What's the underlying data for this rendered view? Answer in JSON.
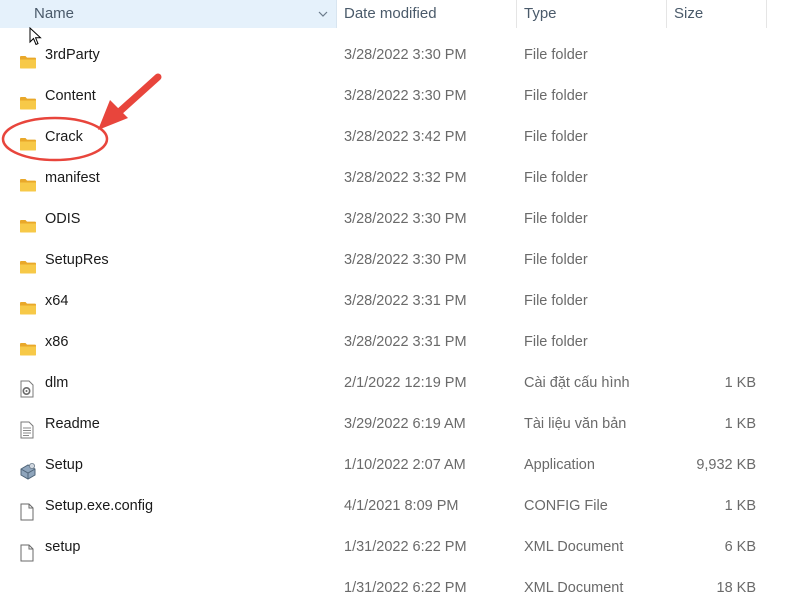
{
  "columns": {
    "name": "Name",
    "date": "Date modified",
    "type": "Type",
    "size": "Size"
  },
  "colors": {
    "folder": "#f4c23d",
    "annotation": "#e8453c",
    "header_selected": "#e5f1fb"
  },
  "rows": [
    {
      "icon": "folder-icon",
      "name": "3rdParty",
      "date": "3/28/2022 3:30 PM",
      "type": "File folder",
      "size": ""
    },
    {
      "icon": "folder-icon",
      "name": "Content",
      "date": "3/28/2022 3:30 PM",
      "type": "File folder",
      "size": ""
    },
    {
      "icon": "folder-icon",
      "name": "Crack",
      "date": "3/28/2022 3:42 PM",
      "type": "File folder",
      "size": ""
    },
    {
      "icon": "folder-icon",
      "name": "manifest",
      "date": "3/28/2022 3:32 PM",
      "type": "File folder",
      "size": ""
    },
    {
      "icon": "folder-icon",
      "name": "ODIS",
      "date": "3/28/2022 3:30 PM",
      "type": "File folder",
      "size": ""
    },
    {
      "icon": "folder-icon",
      "name": "SetupRes",
      "date": "3/28/2022 3:30 PM",
      "type": "File folder",
      "size": ""
    },
    {
      "icon": "folder-icon",
      "name": "x64",
      "date": "3/28/2022 3:31 PM",
      "type": "File folder",
      "size": ""
    },
    {
      "icon": "folder-icon",
      "name": "x86",
      "date": "3/28/2022 3:31 PM",
      "type": "File folder",
      "size": ""
    },
    {
      "icon": "config-settings-icon",
      "name": "dlm",
      "date": "2/1/2022 12:19 PM",
      "type": "Cài đặt cấu hình",
      "size": "1 KB"
    },
    {
      "icon": "text-document-icon",
      "name": "Readme",
      "date": "3/29/2022 6:19 AM",
      "type": "Tài liệu văn bản",
      "size": "1 KB"
    },
    {
      "icon": "setup-installer-icon",
      "name": "Setup",
      "date": "1/10/2022 2:07 AM",
      "type": "Application",
      "size": "9,932 KB"
    },
    {
      "icon": "blank-file-icon",
      "name": "Setup.exe.config",
      "date": "4/1/2021 8:09 PM",
      "type": "CONFIG File",
      "size": "1 KB"
    },
    {
      "icon": "blank-file-icon",
      "name": "setup",
      "date": "1/31/2022 6:22 PM",
      "type": "XML Document",
      "size": "6 KB"
    },
    {
      "icon": "",
      "name": "",
      "date": "1/31/2022 6:22 PM",
      "type": "XML Document",
      "size": "18 KB"
    }
  ]
}
